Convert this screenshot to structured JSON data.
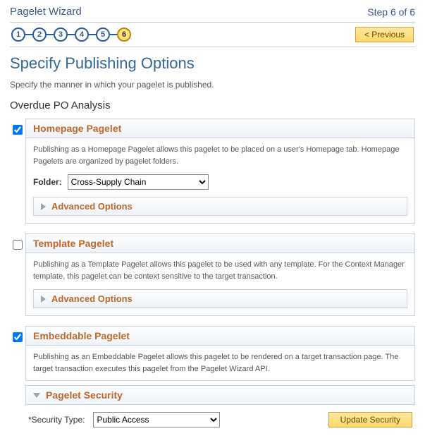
{
  "header": {
    "wizard_title": "Pagelet Wizard",
    "step_of": "Step 6 of 6",
    "previous_label": "< Previous",
    "steps": [
      "1",
      "2",
      "3",
      "4",
      "5",
      "6"
    ],
    "current_step_index": 5
  },
  "title": "Specify Publishing Options",
  "description": "Specify the manner in which your pagelet is published.",
  "section_name": "Overdue PO Analysis",
  "homepage": {
    "checked": true,
    "title": "Homepage Pagelet",
    "desc": "Publishing as a Homepage Pagelet allows this pagelet to be placed on a user's Homepage tab. Homepage Pagelets are organized by pagelet folders.",
    "folder_label": "Folder:",
    "folder_value": "Cross-Supply Chain",
    "advanced_label": "Advanced Options"
  },
  "template": {
    "checked": false,
    "title": "Template Pagelet",
    "desc": "Publishing as a Template Pagelet allows this pagelet to be used with any template. For the Context Manager template, this pagelet can be context sensitive to the target transaction.",
    "advanced_label": "Advanced Options"
  },
  "embeddable": {
    "checked": true,
    "title": "Embeddable Pagelet",
    "desc": "Publishing as an Embeddable Pagelet allows this pagelet to be rendered on a target transaction page. The target transaction executes this pagelet from the Pagelet Wizard API."
  },
  "security": {
    "title": "Pagelet Security",
    "type_label": "*Security Type:",
    "type_value": "Public Access",
    "update_label": "Update Security"
  }
}
